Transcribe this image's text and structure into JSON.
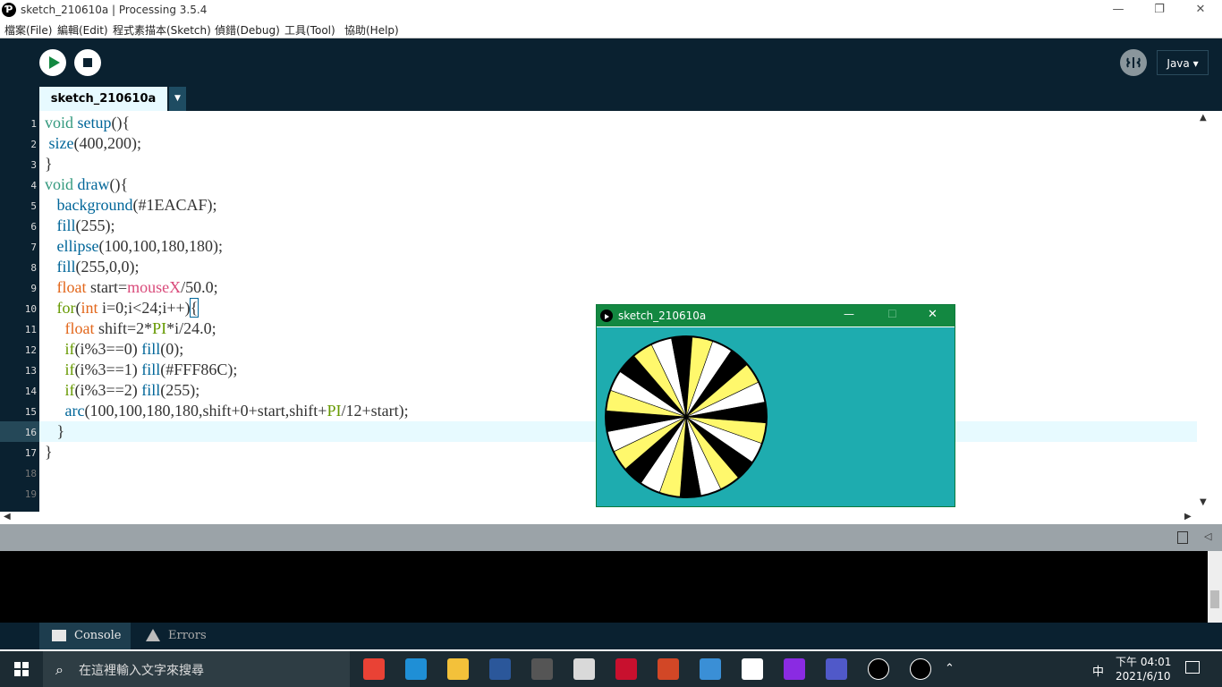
{
  "window": {
    "title": "sketch_210610a | Processing 3.5.4",
    "logo_glyph": "Ƥ",
    "minimize": "—",
    "maximize": "❐",
    "close": "✕"
  },
  "menu": [
    "檔案(File)",
    "編輯(Edit)",
    "程式素描本(Sketch)",
    "偵錯(Debug)",
    "工具(Tool)",
    "協助(Help)"
  ],
  "toolbar": {
    "run_icon": "play-icon",
    "stop_icon": "stop-icon",
    "debugger_icon": "butterfly-icon",
    "mode": "Java ▾"
  },
  "tabs": {
    "active": "sketch_210610a",
    "menu_arrow": "▼"
  },
  "editor": {
    "line_numbers": [
      "1",
      "2",
      "3",
      "4",
      "5",
      "6",
      "7",
      "8",
      "9",
      "10",
      "11",
      "12",
      "13",
      "14",
      "15",
      "16",
      "17",
      "18",
      "19"
    ],
    "current_line": 16,
    "lines": [
      "void setup(){",
      " size(400,200);",
      "}",
      "void draw(){",
      "   background(#1EACAF);",
      "   fill(255);",
      "   ellipse(100,100,180,180);",
      "   fill(255,0,0);",
      "   float start=mouseX/50.0;",
      "   for(int i=0;i<24;i++){",
      "     float shift=2*PI*i/24.0;",
      "     if(i%3==0) fill(0);",
      "     if(i%3==1) fill(#FFF86C);",
      "     if(i%3==2) fill(255);",
      "     arc(100,100,180,180,shift+0+start,shift+PI/12+start);",
      "   }",
      "}",
      "",
      ""
    ]
  },
  "sketch_window": {
    "title": "sketch_210610a",
    "background": "#1EACAF",
    "colors": [
      "#000000",
      "#FFF86C",
      "#FFFFFF"
    ],
    "segments": 24,
    "minimize": "—",
    "maximize": "☐",
    "close": "✕"
  },
  "console": {
    "tab_console": "Console",
    "tab_errors": "Errors"
  },
  "taskbar": {
    "search_placeholder": "在這裡輸入文字來搜尋",
    "clock_time": "下午 04:01",
    "clock_date": "2021/6/10",
    "ime": "中",
    "apps": [
      "chrome-icon",
      "edge-icon",
      "explorer-icon",
      "word-icon",
      "media-icon",
      "paint-icon",
      "garena-icon",
      "powerpoint-icon",
      "control-panel-icon",
      "code-icon",
      "winrar-icon",
      "teams-icon",
      "processing-icon",
      "sketch-run-icon"
    ]
  }
}
